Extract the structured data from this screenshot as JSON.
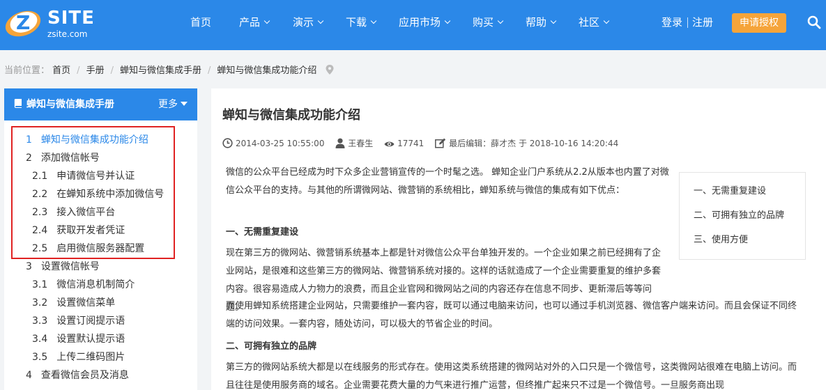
{
  "brand": {
    "site": "SITE",
    "domain": "zsite.com"
  },
  "nav": {
    "items": [
      {
        "label": "首页",
        "dropdown": false
      },
      {
        "label": "产品",
        "dropdown": true
      },
      {
        "label": "演示",
        "dropdown": true
      },
      {
        "label": "下载",
        "dropdown": true
      },
      {
        "label": "应用市场",
        "dropdown": true
      },
      {
        "label": "购买",
        "dropdown": true
      },
      {
        "label": "帮助",
        "dropdown": true
      },
      {
        "label": "社区",
        "dropdown": true
      }
    ],
    "login": "登录",
    "register": "注册",
    "apply": "申请授权"
  },
  "breadcrumb": {
    "prefix": "当前位置：",
    "items": [
      "首页",
      "手册",
      "蝉知与微信集成手册",
      "蝉知与微信集成功能介绍"
    ]
  },
  "sidebar": {
    "title": "蝉知与微信集成手册",
    "more": "更多",
    "items": [
      {
        "num": "1",
        "label": "蝉知与微信集成功能介绍",
        "active": true
      },
      {
        "num": "2",
        "label": "添加微信帐号"
      },
      {
        "num": "2.1",
        "label": "申请微信号并认证"
      },
      {
        "num": "2.2",
        "label": "在蝉知系统中添加微信号"
      },
      {
        "num": "2.3",
        "label": "接入微信平台"
      },
      {
        "num": "2.4",
        "label": "获取开发者凭证"
      },
      {
        "num": "2.5",
        "label": "启用微信服务器配置"
      },
      {
        "num": "3",
        "label": "设置微信帐号"
      },
      {
        "num": "3.1",
        "label": "微信消息机制简介"
      },
      {
        "num": "3.2",
        "label": "设置微信菜单"
      },
      {
        "num": "3.3",
        "label": "设置订阅提示语"
      },
      {
        "num": "3.4",
        "label": "设置默认提示语"
      },
      {
        "num": "3.5",
        "label": "上传二维码图片"
      },
      {
        "num": "4",
        "label": "查看微信会员及消息"
      }
    ]
  },
  "article": {
    "title": "蝉知与微信集成功能介绍",
    "meta": {
      "date": "2014-03-25 10:55:00",
      "author": "王春生",
      "views": "17741",
      "edited": "最后编辑：薛才杰 于 2018-10-16 14:20:44"
    },
    "intro": "微信的公众平台已经成为时下众多企业营销宣传的一个时髦之选。 蝉知企业门户系统从2.2从版本也内置了对微信公众平台的支持。与其他的所谓微网站、微营销的系统相比，蝉知系统与微信的集成有如下优点：",
    "section1_title": "一、无需重复建设",
    "section1_p1": "现在第三方的微网站、微营销系统基本上都是针对微信公众平台单独开发的。一个企业如果之前已经拥有了企业网站，是很难和这些第三方的微网站、微营销系统对接的。这样的话就造成了一个企业需要重复的维护多套内容。很容易造成人力物力的浪费，而且企业官网和微网站之间的内容还存在信息不同步、更新滞后等等问题。",
    "section1_p2": "而使用蝉知系统搭建企业网站，只需要维护一套内容，既可以通过电脑来访问，也可以通过手机浏览器、微信客户端来访问。而且会保证不同终端的访问效果。一套内容，随处访问，可以极大的节省企业的时间。",
    "section2_title": "二、可拥有独立的品牌",
    "section2_p1": "第三方的微网站系统大都是以在线服务的形式存在。使用这类系统搭建的微网站对外的入口只是一个微信号，这类微网站很难在电脑上访问。而且往往是使用服务商的域名。企业需要花费大量的力气来进行推广运营，但终推广起来只不过是一个微信号。一旦服务商出现",
    "toc": [
      "一、无需重复建设",
      "二、可拥有独立的品牌",
      "三、使用方便"
    ]
  }
}
